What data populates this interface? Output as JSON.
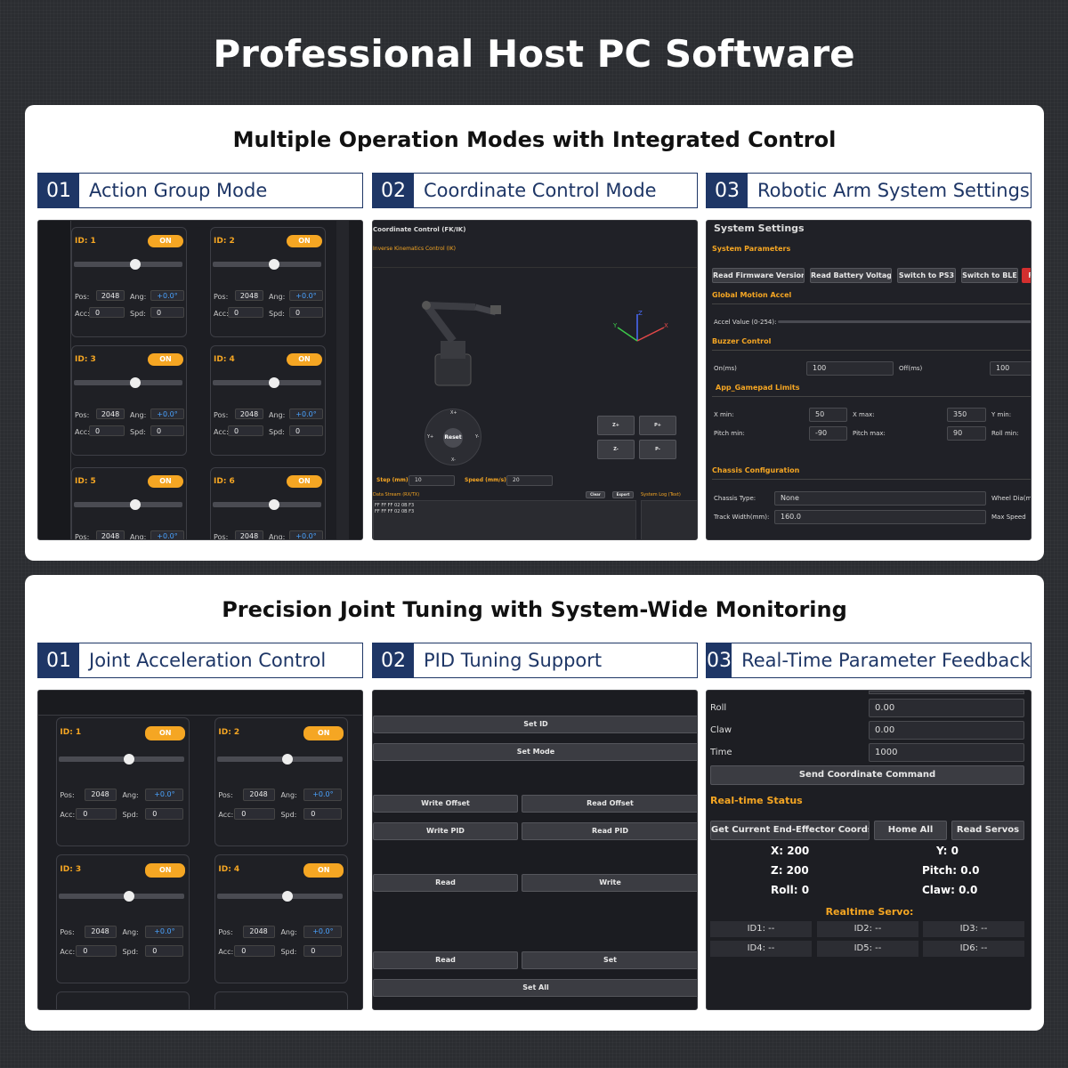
{
  "title": "Professional Host PC Software",
  "section1": {
    "title": "Multiple Operation Modes with Integrated Control",
    "tabs": [
      {
        "num": "01",
        "label": "Action Group Mode"
      },
      {
        "num": "02",
        "label": "Coordinate Control Mode"
      },
      {
        "num": "03",
        "label": "Robotic Arm System Settings"
      }
    ]
  },
  "section2": {
    "title": "Precision Joint Tuning with System-Wide Monitoring",
    "tabs": [
      {
        "num": "01",
        "label": "Joint Acceleration Control"
      },
      {
        "num": "02",
        "label": "PID Tuning Support"
      },
      {
        "num": "03",
        "label": "Real-Time Parameter Feedback"
      }
    ]
  },
  "servo": {
    "ids": [
      "ID: 1",
      "ID: 2",
      "ID: 3",
      "ID: 4",
      "ID: 5",
      "ID: 6"
    ],
    "on": "ON",
    "pos_label": "Pos:",
    "ang_label": "Ang:",
    "acc_label": "Acc:",
    "spd_label": "Spd:",
    "pos": "2048",
    "ang": "+0.0°",
    "acc": "0",
    "spd": "0"
  },
  "coord": {
    "title": "Coordinate Control (FK/IK)",
    "subtitle": "Inverse Kinematics Control (IK)",
    "reset": "Reset",
    "xp": "X+",
    "xm": "X-",
    "yp": "Y+",
    "ym": "Y-",
    "zp": "Z+",
    "zm": "Z-",
    "pp": "P+",
    "pm": "P-",
    "step_label": "Step (mm):",
    "step": "10",
    "speed_label": "Speed (mm/s):",
    "speed": "20",
    "data_stream": "Data Stream (RX/TX)",
    "clear": "Clear",
    "export": "Export",
    "syslog": "System Log (Text)",
    "rx1": "FF FF FF 02 0B F3",
    "rx2": "FF FF FF 02 0B F3",
    "ax_z": "Z",
    "ax_x": "X",
    "ax_y": "Y"
  },
  "settings": {
    "title": "System Settings",
    "params": "System Parameters",
    "b1": "Read Firmware Version",
    "b2": "Read Battery Voltage",
    "b3": "Switch to PS3",
    "b4": "Switch to BLE",
    "b5": "F",
    "accel_title": "Global Motion Accel",
    "accel_label": "Accel Value (0-254):",
    "buzzer": "Buzzer Control",
    "on_ms": "On(ms)",
    "on_val": "100",
    "off_ms": "Off(ms)",
    "off_val": "100",
    "limits": "App_Gamepad Limits",
    "xmin": "X min:",
    "xmin_v": "50",
    "xmax": "X max:",
    "xmax_v": "350",
    "ymin": "Y min:",
    "pmin": "Pitch min:",
    "pmin_v": "-90",
    "pmax": "Pitch max:",
    "pmax_v": "90",
    "rmin": "Roll min:",
    "chassis": "Chassis Configuration",
    "ctype": "Chassis Type:",
    "ctype_v": "None",
    "wheel": "Wheel Dia(m",
    "track": "Track Width(mm):",
    "track_v": "160.0",
    "maxspd": "Max Speed"
  },
  "pid": {
    "set_id": "Set ID",
    "set_mode": "Set Mode",
    "write_offset": "Write Offset",
    "read_offset": "Read Offset",
    "write_pid": "Write PID",
    "read_pid": "Read PID",
    "read1": "Read",
    "write": "Write",
    "read2": "Read",
    "set": "Set",
    "set_all": "Set All"
  },
  "feedback": {
    "roll": "Roll",
    "roll_v": "0.00",
    "claw": "Claw",
    "claw_v": "0.00",
    "time": "Time",
    "time_v": "1000",
    "send": "Send Coordinate Command",
    "rt_status": "Real-time Status",
    "get": "Get Current End-Effector Coords",
    "home": "Home All",
    "readservos": "Read Servos",
    "x": "X: 200",
    "y": "Y: 0",
    "z": "Z: 200",
    "pitch": "Pitch: 0.0",
    "rollv": "Roll: 0",
    "clawv": "Claw: 0.0",
    "rt_servo": "Realtime Servo:",
    "ids": [
      "ID1: --",
      "ID2: --",
      "ID3: --",
      "ID4: --",
      "ID5: --",
      "ID6: --"
    ]
  }
}
